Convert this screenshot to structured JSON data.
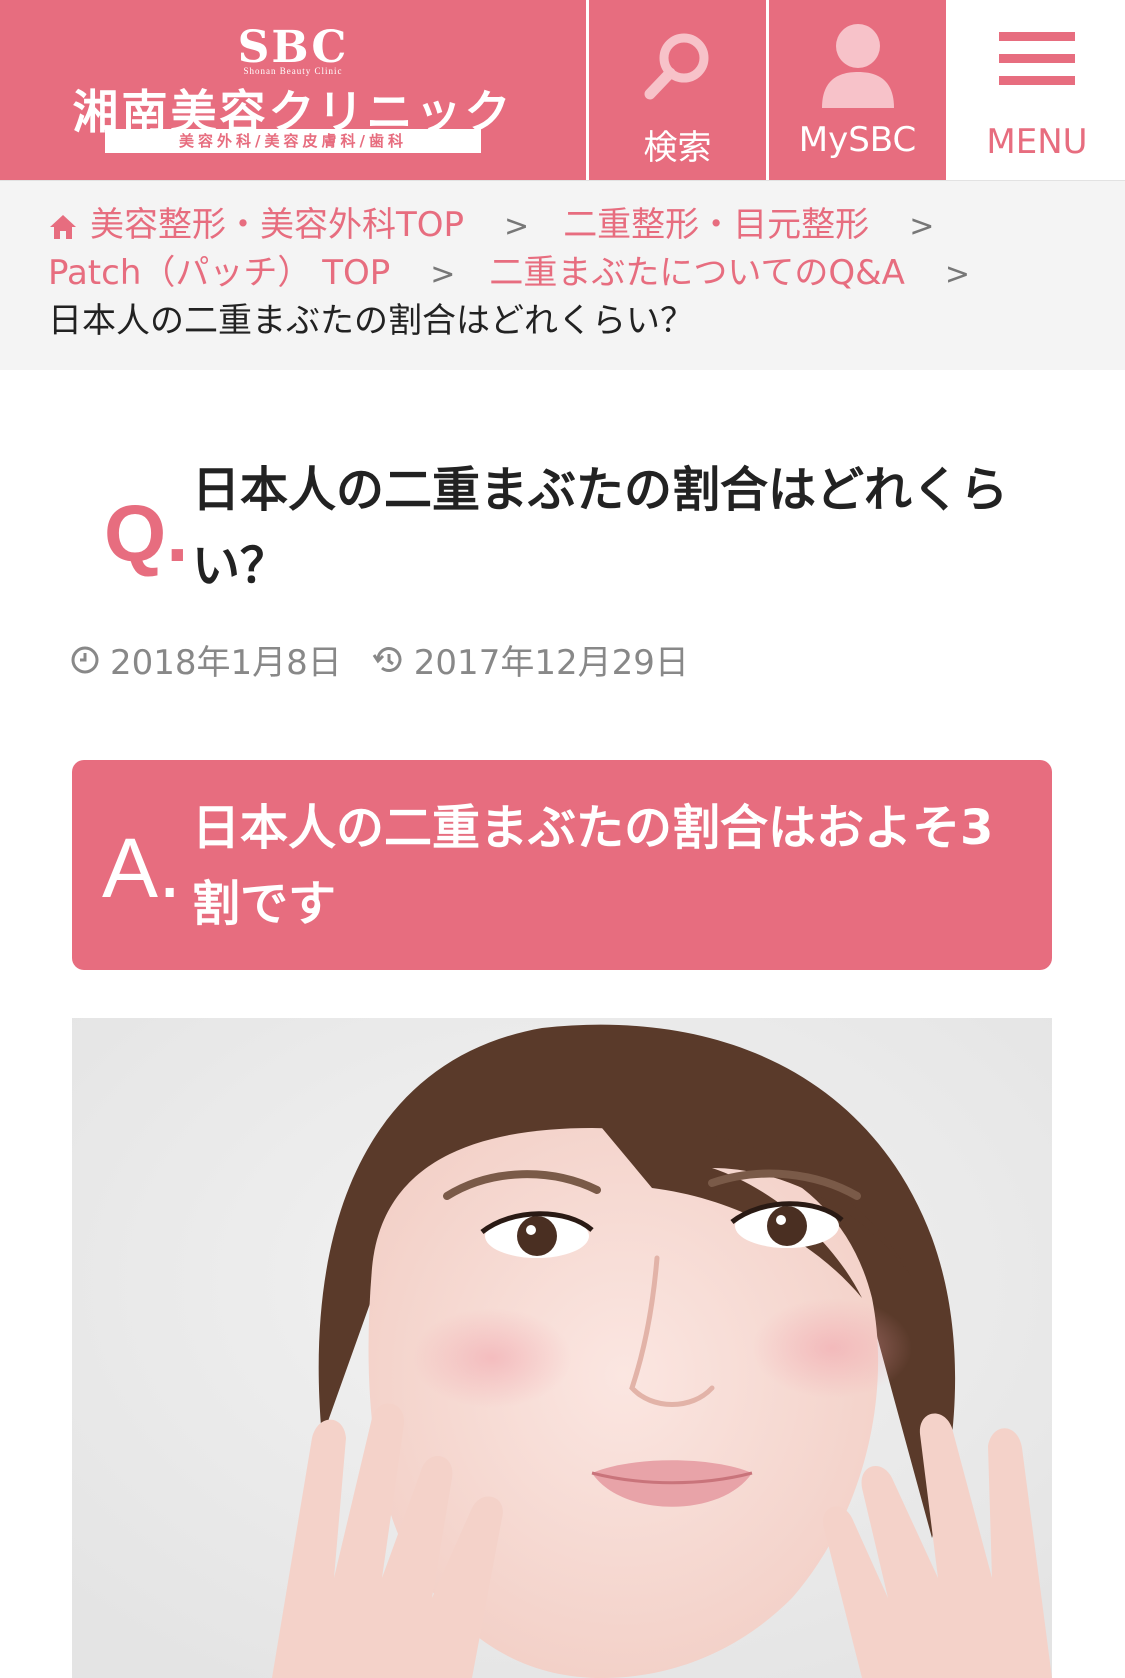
{
  "header": {
    "logo": {
      "brand": "SBC",
      "brand_sub": "Shonan Beauty Clinic",
      "name": "湘南美容クリニック",
      "tagline": "美容外科/美容皮膚科/歯科"
    },
    "search_label": "検索",
    "mysbc_label": "MySBC",
    "menu_label": "MENU",
    "colors": {
      "brand": "#e76d7f"
    }
  },
  "breadcrumb": {
    "items": [
      "美容整形・美容外科TOP",
      "二重整形・目元整形",
      "Patch（パッチ） TOP",
      "二重まぶたについてのQ&A"
    ],
    "current": "日本人の二重まぶたの割合はどれくらい？",
    "separator": ">"
  },
  "question": {
    "mark": "Q.",
    "text": "日本人の二重まぶたの割合はどれくらい？"
  },
  "meta": {
    "published": "2018年1月8日",
    "updated": "2017年12月29日"
  },
  "answer": {
    "mark": "A.",
    "text": "日本人の二重まぶたの割合はおよそ3割です"
  }
}
